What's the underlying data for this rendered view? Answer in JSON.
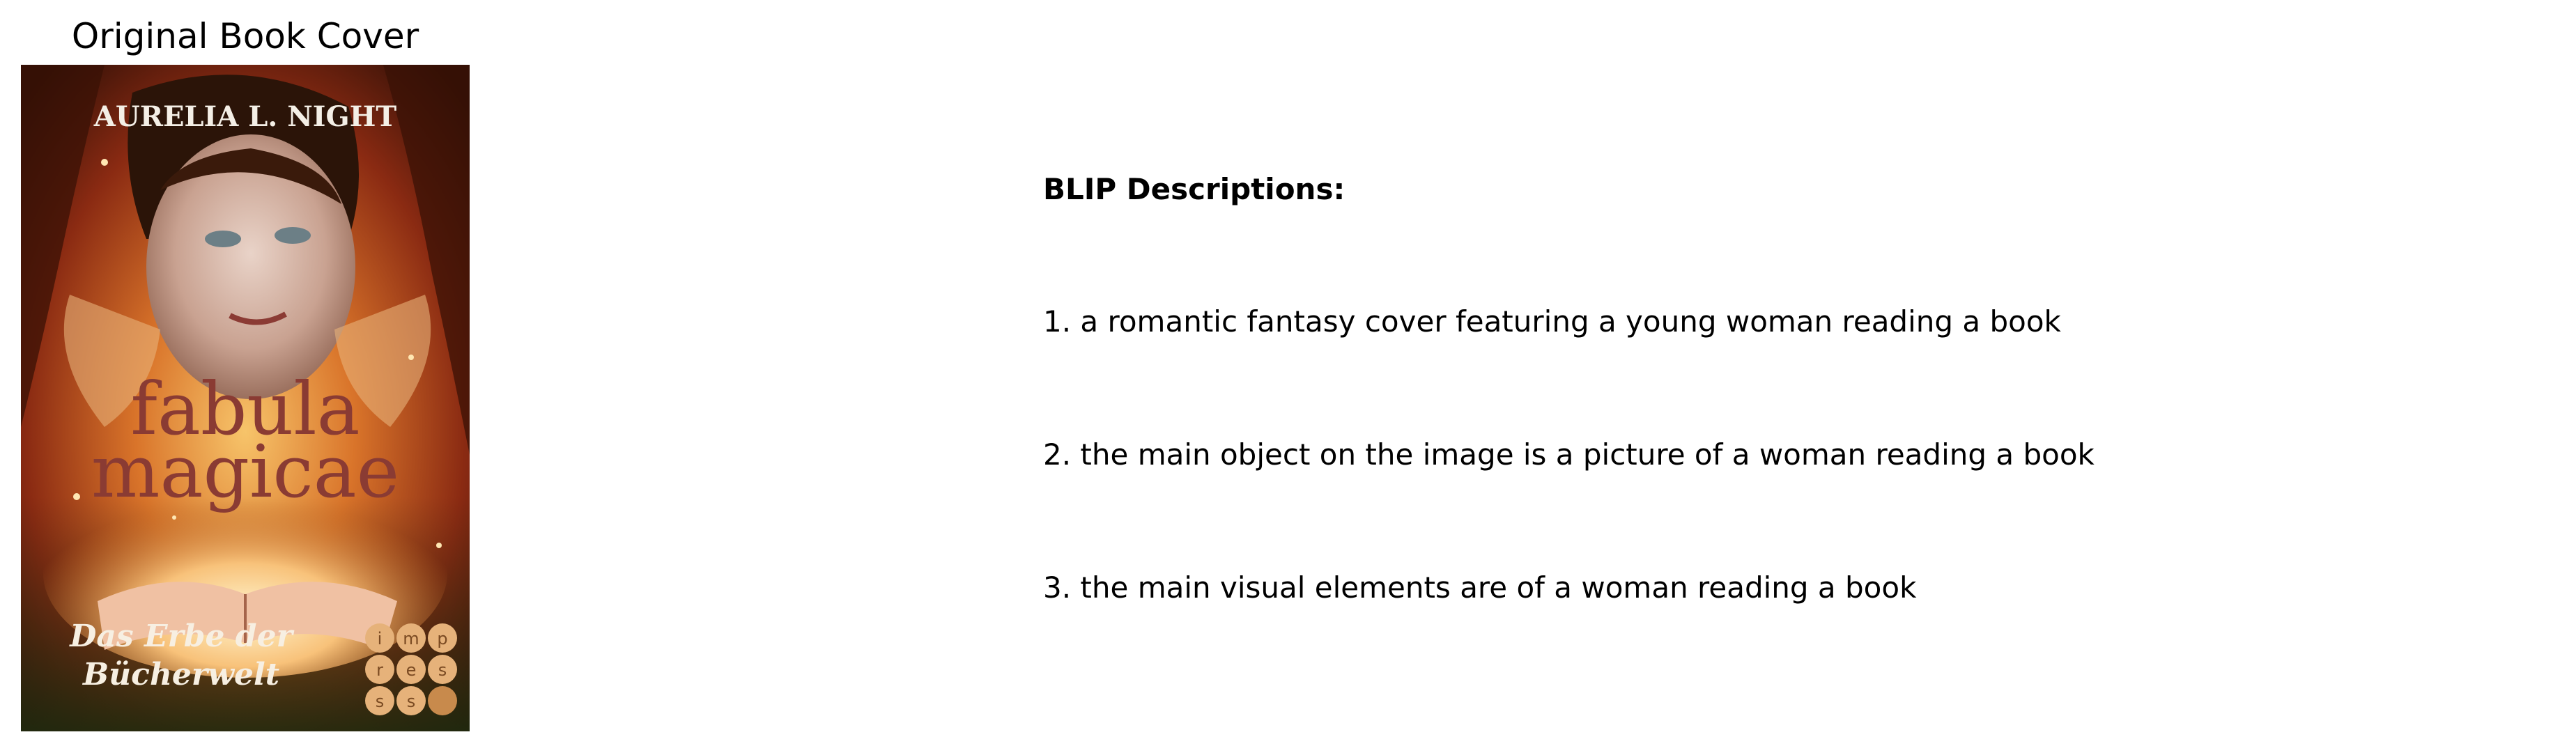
{
  "cover_panel": {
    "heading": "Original Book Cover",
    "cover_art": {
      "author": "AURELIA L. NIGHT",
      "title_line1": "fabula",
      "title_line2": "magicae",
      "subtitle_line1": "Das Erbe der",
      "subtitle_line2": "Bücherwelt",
      "publisher_letters": [
        "i",
        "m",
        "p",
        "r",
        "e",
        "s",
        "s"
      ]
    }
  },
  "descriptions_panel": {
    "heading": "BLIP Descriptions:",
    "items": [
      "1. a romantic fantasy cover featuring a young woman reading a book",
      "2. the main object on the image is a picture of a woman reading a book",
      "3. the main visual elements are of a woman reading a book"
    ]
  }
}
